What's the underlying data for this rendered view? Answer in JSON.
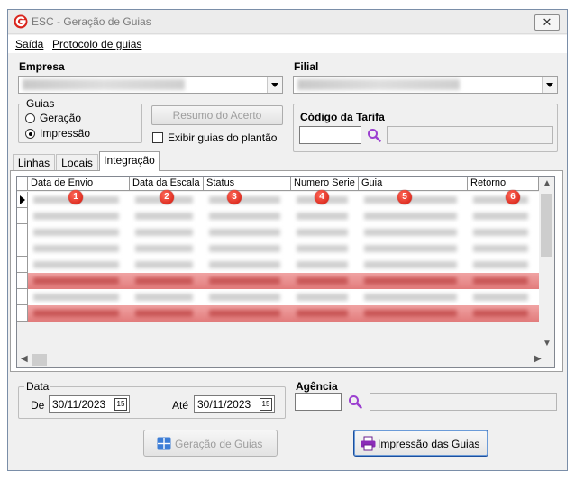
{
  "window": {
    "title": "ESC - Geração de Guias",
    "close_glyph": "✕"
  },
  "menu": {
    "items": [
      "Saída",
      "Protocolo de guias"
    ]
  },
  "empresa": {
    "label": "Empresa"
  },
  "filial": {
    "label": "Filial"
  },
  "guias_group": {
    "legend": "Guias",
    "options": [
      "Geração",
      "Impressão"
    ],
    "selected": "Impressão"
  },
  "resumo_button": {
    "label": "Resumo do Acerto"
  },
  "exibir_checkbox": {
    "label": "Exibir guias do plantão"
  },
  "tarifa": {
    "label": "Código da Tarifa"
  },
  "tabs": [
    {
      "label": "Linhas"
    },
    {
      "label": "Locais"
    },
    {
      "label": "Integração"
    }
  ],
  "grid": {
    "columns": [
      "Data de Envio",
      "Data da Escala",
      "Status",
      "Numero Serie",
      "Guia",
      "Retorno"
    ],
    "badges": [
      "1",
      "2",
      "3",
      "4",
      "5",
      "6"
    ]
  },
  "data_group": {
    "legend": "Data",
    "de_label": "De",
    "de_value": "30/11/2023",
    "ate_label": "Até",
    "ate_value": "30/11/2023",
    "cal_glyph": "15"
  },
  "agencia": {
    "label": "Agência"
  },
  "geracao_button": {
    "label": "Geração de Guias"
  },
  "impressao_button": {
    "label": "Impressão das Guias"
  },
  "colors": {
    "highlight_row": "#e98a8a",
    "accent_blue": "#1b4f9e",
    "search_purple": "#9b3fd0",
    "badge_red": "#d0150a"
  }
}
